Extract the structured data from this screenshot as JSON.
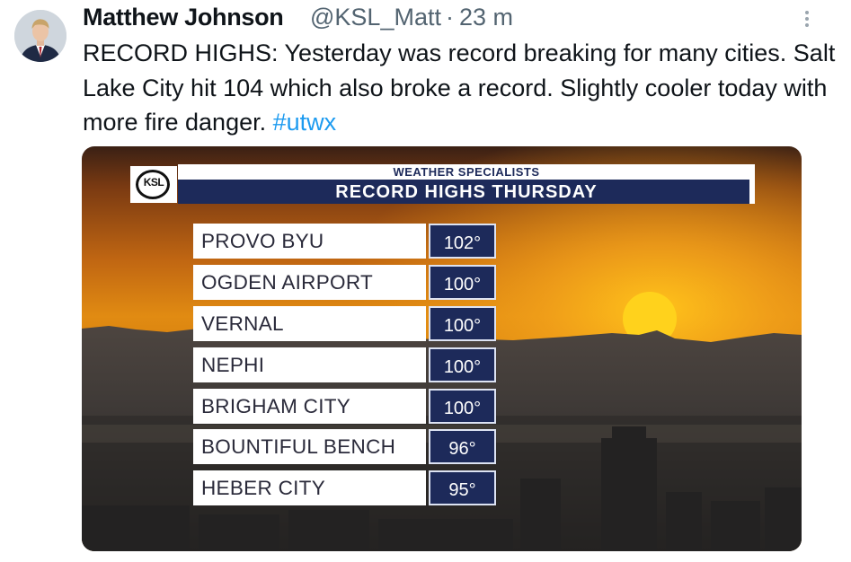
{
  "tweet": {
    "author_name": "Matthew Johnson",
    "author_handle": "@KSL_Matt",
    "separator": "·",
    "time": "23 m",
    "text": "RECORD HIGHS: Yesterday was record breaking for many cities. Salt Lake City hit 104 which also broke a record. Slightly cooler today with more fire danger.",
    "hashtag": "#utwx",
    "more_icon": "more-vertical-icon"
  },
  "graphic": {
    "logo": "KSL",
    "subtitle": "WEATHER SPECIALISTS",
    "title": "RECORD HIGHS THURSDAY",
    "rows": [
      {
        "city": "PROVO BYU",
        "temp": "102°"
      },
      {
        "city": "OGDEN AIRPORT",
        "temp": "100°"
      },
      {
        "city": "VERNAL",
        "temp": "100°"
      },
      {
        "city": "NEPHI",
        "temp": "100°"
      },
      {
        "city": "BRIGHAM CITY",
        "temp": "100°"
      },
      {
        "city": "BOUNTIFUL BENCH",
        "temp": "96°"
      },
      {
        "city": "HEBER CITY",
        "temp": "95°"
      }
    ]
  },
  "colors": {
    "link": "#1d9bf0",
    "navy": "#1d2a5a",
    "handle_gray": "#536471"
  }
}
